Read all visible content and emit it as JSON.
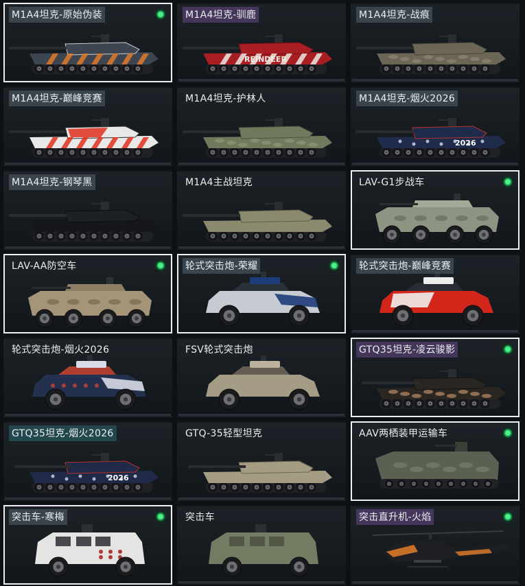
{
  "vehicles": [
    {
      "name": "M1A4坦克-原始伪装",
      "kind": "tank",
      "skin": "orange-camo",
      "selected": true,
      "owned": true,
      "tag": "gray",
      "colors": {
        "body": "#3d4650",
        "accent": "#e07a2a",
        "accent2": "#c9ced2"
      }
    },
    {
      "name": "M1A4坦克-驯鹿",
      "kind": "tank",
      "skin": "reindeer",
      "selected": false,
      "owned": false,
      "tag": "purple",
      "colors": {
        "body": "#a81e22",
        "accent": "#ece8e0",
        "accent2": "#6e1013"
      },
      "decal": "REINDEER"
    },
    {
      "name": "M1A4坦克-战痕",
      "kind": "tank",
      "skin": "battle-worn",
      "selected": false,
      "owned": false,
      "tag": "gray",
      "colors": {
        "body": "#6b6655",
        "accent": "#8d8572",
        "accent2": "#4a463b"
      }
    },
    {
      "name": "M1A4坦克-巅峰竞赛",
      "kind": "tank",
      "skin": "racing",
      "selected": false,
      "owned": false,
      "tag": "gray",
      "colors": {
        "body": "#e8e8e6",
        "accent": "#e0301e",
        "accent2": "#2a2f35"
      }
    },
    {
      "name": "M1A4坦克-护林人",
      "kind": "tank",
      "skin": "ranger",
      "selected": false,
      "owned": false,
      "tag": "none",
      "colors": {
        "body": "#6f7a5c",
        "accent": "#8c9676",
        "accent2": "#4c5540"
      }
    },
    {
      "name": "M1A4坦克-烟火2026",
      "kind": "tank",
      "skin": "fireworks",
      "selected": false,
      "owned": false,
      "tag": "gray",
      "colors": {
        "body": "#1f2b4a",
        "accent": "#d8dce6",
        "accent2": "#b8322a"
      },
      "decal": "2026"
    },
    {
      "name": "M1A4坦克-钢琴黑",
      "kind": "tank",
      "skin": "piano-black",
      "selected": false,
      "owned": false,
      "tag": "gray",
      "colors": {
        "body": "#15171a",
        "accent": "#2c3035",
        "accent2": "#0c0d0f"
      }
    },
    {
      "name": "M1A4主战坦克",
      "kind": "tank",
      "skin": "default",
      "selected": false,
      "owned": false,
      "tag": "none",
      "colors": {
        "body": "#8c8a6e",
        "accent": "#a3a185",
        "accent2": "#5f5e4a"
      }
    },
    {
      "name": "LAV-G1步战车",
      "kind": "ifv8",
      "skin": "default",
      "selected": true,
      "owned": true,
      "tag": "none",
      "colors": {
        "body": "#8d9482",
        "accent": "#a3aa97",
        "accent2": "#5e6356"
      }
    },
    {
      "name": "LAV-AA防空车",
      "kind": "ifv8",
      "skin": "desert",
      "selected": true,
      "owned": true,
      "tag": "none",
      "colors": {
        "body": "#a49478",
        "accent": "#8d7d63",
        "accent2": "#6b5d48"
      }
    },
    {
      "name": "轮式突击炮-荣耀",
      "kind": "car4",
      "skin": "glory",
      "selected": true,
      "owned": true,
      "tag": "gray",
      "colors": {
        "body": "#c7ccd3",
        "accent": "#1e3c7a",
        "accent2": "#2c333b"
      }
    },
    {
      "name": "轮式突击炮-巅峰竞赛",
      "kind": "car4",
      "skin": "racing",
      "selected": false,
      "owned": false,
      "tag": "gray",
      "colors": {
        "body": "#d3261b",
        "accent": "#eeeeee",
        "accent2": "#2a2f35"
      }
    },
    {
      "name": "轮式突击炮-烟火2026",
      "kind": "car4",
      "skin": "fireworks",
      "selected": false,
      "owned": false,
      "tag": "none",
      "colors": {
        "body": "#23314f",
        "accent": "#d8dce6",
        "accent2": "#c24432"
      }
    },
    {
      "name": "FSV轮式突击炮",
      "kind": "car4",
      "skin": "default",
      "selected": false,
      "owned": false,
      "tag": "none",
      "colors": {
        "body": "#a59c86",
        "accent": "#bab29b",
        "accent2": "#6c6656"
      }
    },
    {
      "name": "GTQ35坦克-凌云骏影",
      "kind": "ltank",
      "skin": "horse",
      "selected": true,
      "owned": true,
      "tag": "purple",
      "colors": {
        "body": "#2a2622",
        "accent": "#b08560",
        "accent2": "#16130f"
      }
    },
    {
      "name": "GTQ35坦克-烟火2026",
      "kind": "ltank",
      "skin": "fireworks",
      "selected": false,
      "owned": false,
      "tag": "teal",
      "colors": {
        "body": "#1e2a47",
        "accent": "#d8dce6",
        "accent2": "#b8322a"
      },
      "decal": "2026"
    },
    {
      "name": "GTQ-35轻型坦克",
      "kind": "ltank",
      "skin": "default",
      "selected": false,
      "owned": false,
      "tag": "none",
      "colors": {
        "body": "#a49d84",
        "accent": "#bab39a",
        "accent2": "#6b6553"
      }
    },
    {
      "name": "AAV两栖装甲运输车",
      "kind": "aav",
      "skin": "default",
      "selected": true,
      "owned": true,
      "tag": "none",
      "colors": {
        "body": "#5b6152",
        "accent": "#737a68",
        "accent2": "#3b3f35"
      }
    },
    {
      "name": "突击车-寒梅",
      "kind": "mrap",
      "skin": "plum",
      "selected": true,
      "owned": true,
      "tag": "gray",
      "colors": {
        "body": "#e4e4e2",
        "accent": "#b03a3a",
        "accent2": "#2a2d31"
      }
    },
    {
      "name": "突击车",
      "kind": "mrap",
      "skin": "default",
      "selected": false,
      "owned": false,
      "tag": "none",
      "colors": {
        "body": "#737b62",
        "accent": "#8a9278",
        "accent2": "#4b5040"
      }
    },
    {
      "name": "突击直升机-火焰",
      "kind": "heli",
      "skin": "flame",
      "selected": false,
      "owned": true,
      "tag": "purple",
      "colors": {
        "body": "#1e1f22",
        "accent": "#d8782a",
        "accent2": "#3c3e43"
      }
    }
  ]
}
